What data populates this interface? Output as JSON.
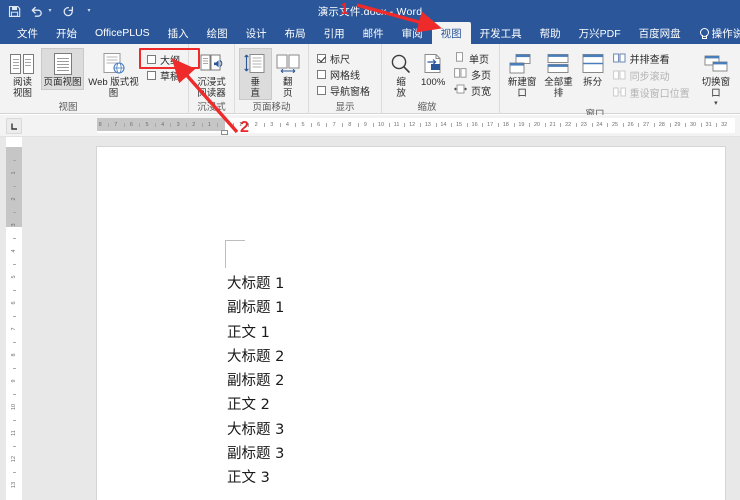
{
  "window": {
    "title": "演示文件.docx  -  Word",
    "quick_access": [
      {
        "name": "save-icon",
        "label": "保存"
      },
      {
        "name": "undo-icon",
        "label": "撤消"
      },
      {
        "name": "redo-icon",
        "label": "恢复"
      },
      {
        "name": "customize-qat-icon",
        "label": "自定义快速访问工具栏"
      }
    ]
  },
  "tabs": [
    {
      "label": "文件",
      "active": false
    },
    {
      "label": "开始",
      "active": false
    },
    {
      "label": "OfficePLUS",
      "active": false
    },
    {
      "label": "插入",
      "active": false
    },
    {
      "label": "绘图",
      "active": false
    },
    {
      "label": "设计",
      "active": false
    },
    {
      "label": "布局",
      "active": false
    },
    {
      "label": "引用",
      "active": false
    },
    {
      "label": "邮件",
      "active": false
    },
    {
      "label": "审阅",
      "active": false
    },
    {
      "label": "视图",
      "active": true
    },
    {
      "label": "开发工具",
      "active": false
    },
    {
      "label": "帮助",
      "active": false
    },
    {
      "label": "万兴PDF",
      "active": false
    },
    {
      "label": "百度网盘",
      "active": false
    }
  ],
  "tell_me": {
    "label": "操作说明搜索",
    "icon": "lightbulb-icon"
  },
  "ribbon": {
    "groups": [
      {
        "label": "视图",
        "buttons": [
          {
            "label": "阅读\n视图",
            "icon": "read-mode-icon",
            "selected": false
          },
          {
            "label": "页面视图",
            "icon": "print-layout-icon",
            "selected": true
          },
          {
            "label": "Web 版式视图",
            "icon": "web-layout-icon",
            "selected": false
          }
        ],
        "checks": [
          {
            "label": "大纲",
            "checked": false,
            "highlighted": true
          },
          {
            "label": "草稿",
            "checked": false,
            "highlighted": true
          }
        ]
      },
      {
        "label": "沉浸式",
        "buttons": [
          {
            "label": "沉浸式\n阅读器",
            "icon": "immersive-reader-icon",
            "selected": false
          }
        ]
      },
      {
        "label": "页面移动",
        "buttons": [
          {
            "label": "垂\n直",
            "icon": "vertical-scroll-icon",
            "selected": true
          },
          {
            "label": "翻\n页",
            "icon": "side-to-side-icon",
            "selected": false
          }
        ]
      },
      {
        "label": "显示",
        "checks": [
          {
            "label": "标尺",
            "checked": true
          },
          {
            "label": "网格线",
            "checked": false
          },
          {
            "label": "导航窗格",
            "checked": false
          }
        ]
      },
      {
        "label": "缩放",
        "buttons": [
          {
            "label": "缩\n放",
            "icon": "zoom-icon",
            "selected": false
          },
          {
            "label": "100%",
            "icon": "zoom-100-icon",
            "selected": false
          }
        ],
        "checks": [
          {
            "label": "单页",
            "checked": false,
            "icon": "one-page-icon"
          },
          {
            "label": "多页",
            "checked": false,
            "icon": "multiple-pages-icon"
          },
          {
            "label": "页宽",
            "checked": false,
            "icon": "page-width-icon"
          }
        ]
      },
      {
        "label": "窗口",
        "buttons": [
          {
            "label": "新建窗口",
            "icon": "new-window-icon",
            "selected": false
          },
          {
            "label": "全部重排",
            "icon": "arrange-all-icon",
            "selected": false
          },
          {
            "label": "拆分",
            "icon": "split-icon",
            "selected": false
          }
        ],
        "rows": [
          {
            "label": "并排查看",
            "icon": "view-side-by-side-icon",
            "disabled": false
          },
          {
            "label": "同步滚动",
            "icon": "synchronous-scrolling-icon",
            "disabled": true
          },
          {
            "label": "重设窗口位置",
            "icon": "reset-window-position-icon",
            "disabled": true
          }
        ],
        "switch_button": {
          "label": "切换窗口",
          "icon": "switch-windows-icon"
        }
      }
    ]
  },
  "ruler": {
    "tab_stop_icon": "left-tab-stop-icon",
    "left_ticks": [
      "8",
      "7",
      "6",
      "5",
      "4",
      "3",
      "2",
      "1"
    ],
    "right_ticks": [
      "1",
      "2",
      "3",
      "4",
      "5",
      "6",
      "7",
      "8",
      "9",
      "10",
      "11",
      "12",
      "13",
      "14",
      "15",
      "16",
      "17",
      "18",
      "19",
      "20",
      "21",
      "22",
      "23",
      "24",
      "25",
      "26",
      "27",
      "28",
      "29",
      "30",
      "31",
      "32"
    ],
    "vertical_ticks": [
      "1",
      "2",
      "3",
      "4",
      "5",
      "6",
      "7",
      "8",
      "9",
      "10",
      "11",
      "12",
      "13"
    ]
  },
  "document": {
    "paragraphs": [
      "大标题 1",
      "副标题 1",
      "正文 1",
      "大标题 2",
      "副标题 2",
      "正文 2",
      "大标题 3",
      "副标题 3",
      "正文 3"
    ]
  },
  "annotations": [
    {
      "number": "1",
      "target": "view-tab"
    },
    {
      "number": "2",
      "target": "outline-draft-checkboxes"
    }
  ],
  "colors": {
    "brand": "#2b579a",
    "ribbon_bg": "#f3f3f3",
    "annotation_red": "#ee2a2a",
    "workspace_bg": "#e8e8e8",
    "page_bg": "#ffffff"
  }
}
